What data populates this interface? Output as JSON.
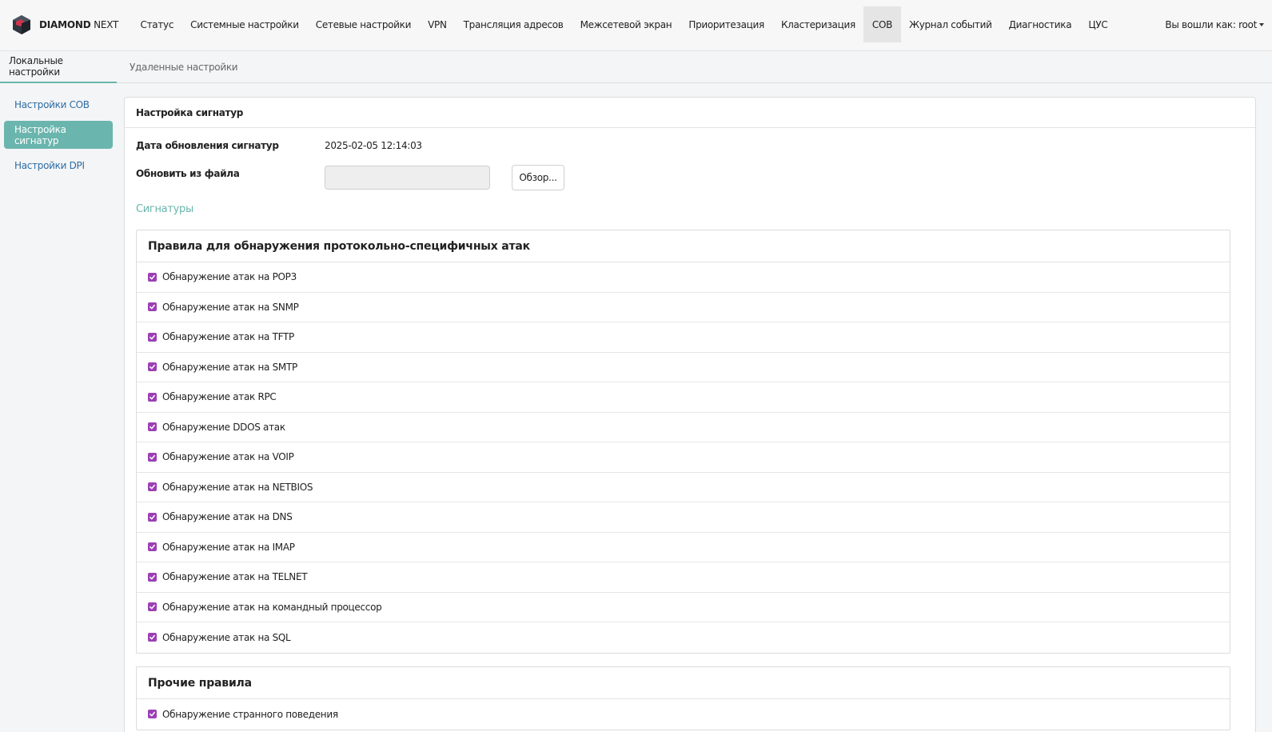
{
  "brand": {
    "bold": "DIAMOND",
    "light": "NEXT"
  },
  "nav": [
    "Статус",
    "Системные настройки",
    "Сетевые настройки",
    "VPN",
    "Трансляция адресов",
    "Межсетевой экран",
    "Приоритезация",
    "Кластеризация",
    "СОВ",
    "Журнал событий",
    "Диагностика",
    "ЦУС"
  ],
  "nav_active_index": 8,
  "user_menu": "Вы вошли как: root",
  "subtabs": [
    "Локальные настройки",
    "Удаленные настройки"
  ],
  "sidebar": [
    "Настройки СОВ",
    "Настройка сигнатур",
    "Настройки DPI"
  ],
  "panel": {
    "heading": "Настройка сигнатур",
    "date_label": "Дата обновления сигнатур",
    "date_value": "2025-02-05 12:14:03",
    "file_label": "Обновить из файла",
    "browse_label": "Обзор...",
    "section_title": "Сигнатуры"
  },
  "groups": [
    {
      "title": "Правила для обнаружения протокольно-специфичных атак",
      "rules": [
        "Обнаружение атак на POP3",
        "Обнаружение атак на SNMP",
        "Обнаружение атак на TFTP",
        "Обнаружение атак на SMTP",
        "Обнаружение атак RPC",
        "Обнаружение DDOS атак",
        "Обнаружение атак на VOIP",
        "Обнаружение атак на NETBIOS",
        "Обнаружение атак на DNS",
        "Обнаружение атак на IMAP",
        "Обнаружение атак на TELNET",
        "Обнаружение атак на командный процессор",
        "Обнаружение атак на SQL"
      ]
    },
    {
      "title": "Прочие правила",
      "rules": [
        "Обнаружение странного поведения"
      ]
    }
  ],
  "colors": {
    "accent": "#6ab5ad",
    "checkbox": "#9c3fb5",
    "link": "#2e6da4"
  },
  "icons": {
    "logo": "diamond-logo-icon",
    "checkbox": "check-icon",
    "caret": "caret-down-icon"
  }
}
